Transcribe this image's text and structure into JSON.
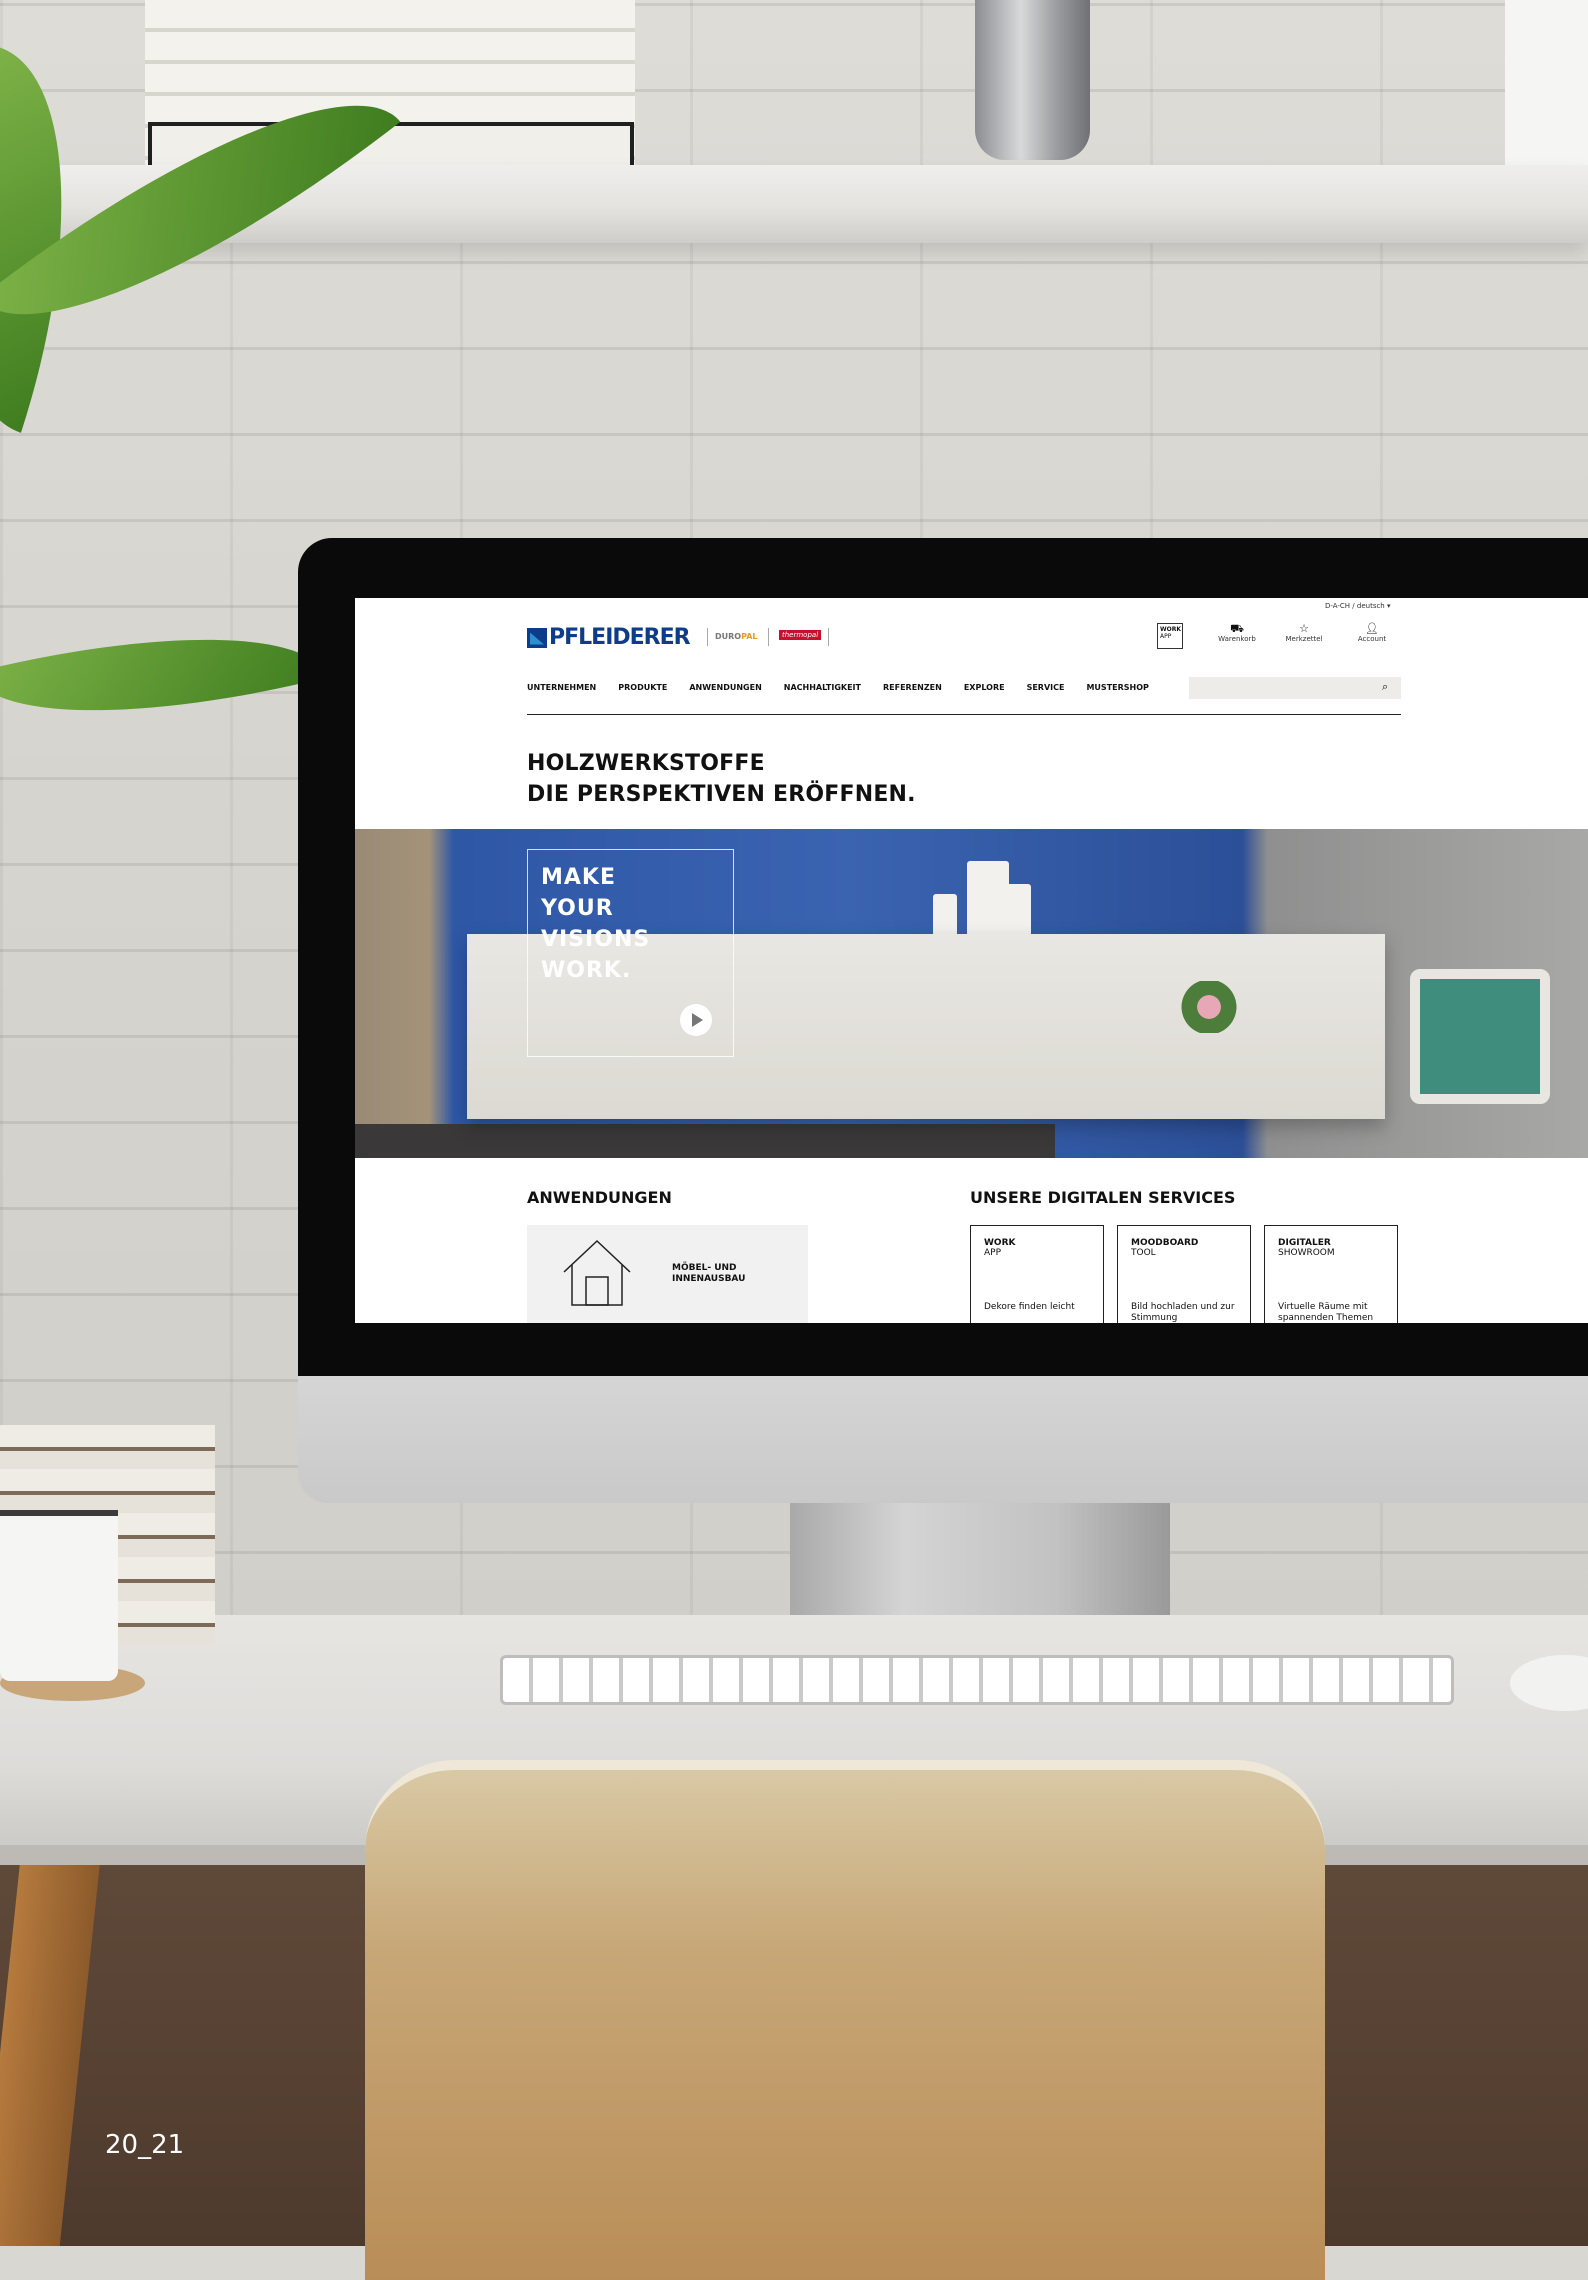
{
  "colors": {
    "brand_blue": "#0d3c8a",
    "hero_blue": "#3a63b0",
    "thermopal_red": "#c8102e",
    "duropal_orange": "#e89a1c",
    "search_bg": "#eeece9"
  },
  "page_number": "20_21",
  "website": {
    "locale_selector": "D-A-CH / deutsch",
    "locale_icon": "chevron-down-icon",
    "logo_text": "PFLEIDERER",
    "brands": {
      "duropal_a": "DURO",
      "duropal_b": "PAL",
      "thermopal": "thermopal"
    },
    "header_icons": {
      "work_app_title": "WORK",
      "work_app_sub": "APP",
      "cart": {
        "label": "Warenkorb",
        "icon": "cart-icon"
      },
      "wishlist": {
        "label": "Merkzettel",
        "icon": "star-icon"
      },
      "account": {
        "label": "Account",
        "icon": "user-icon"
      }
    },
    "nav": [
      "UNTERNEHMEN",
      "PRODUKTE",
      "ANWENDUNGEN",
      "NACHHALTIGKEIT",
      "REFERENZEN",
      "EXPLORE",
      "SERVICE",
      "MUSTERSHOP"
    ],
    "search": {
      "value": "",
      "icon": "search-icon"
    },
    "headline_line1": "HOLZWERKSTOFFE",
    "headline_line2": "DIE PERSPEKTIVEN ERÖFFNEN.",
    "hero": {
      "line1": "MAKE",
      "line2": "YOUR",
      "line3": "VISIONS",
      "line4": "WORK.",
      "play_icon": "play-icon"
    },
    "applications": {
      "title": "ANWENDUNGEN",
      "card_line1": "MÖBEL- UND",
      "card_line2": "INNENAUSBAU",
      "card_icon": "house-icon"
    },
    "services": {
      "title": "UNSERE DIGITALEN SERVICES",
      "cards": [
        {
          "title": "WORK",
          "sub": "APP",
          "desc": "Dekore finden leicht"
        },
        {
          "title": "MOODBOARD",
          "sub": "TOOL",
          "desc": "Bild hochladen und zur Stimmung"
        },
        {
          "title": "DIGITALER",
          "sub": "SHOWROOM",
          "desc": "Virtuelle Räume mit spannenden Themen"
        }
      ]
    }
  }
}
